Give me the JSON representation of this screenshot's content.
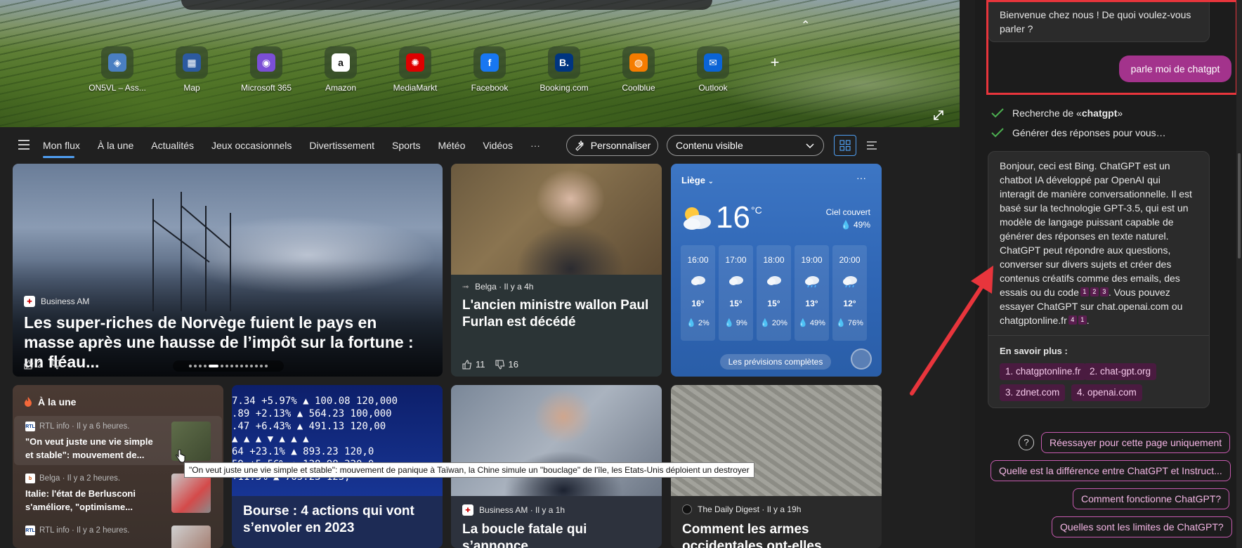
{
  "quicklinks": [
    {
      "label": "ON5VL – Ass...",
      "icon": "globe-icon",
      "color": "#4a7fc1",
      "glyph": "◈"
    },
    {
      "label": "Map",
      "icon": "map-icon",
      "color": "#2c5aa0",
      "glyph": "▦"
    },
    {
      "label": "Microsoft 365",
      "icon": "m365-icon",
      "color": "#7b4fd6",
      "glyph": "◉"
    },
    {
      "label": "Amazon",
      "icon": "amazon-icon",
      "color": "#ffffff",
      "glyph": "a"
    },
    {
      "label": "MediaMarkt",
      "icon": "mediamarkt-icon",
      "color": "#df0000",
      "glyph": "✺"
    },
    {
      "label": "Facebook",
      "icon": "facebook-icon",
      "color": "#1877f2",
      "glyph": "f"
    },
    {
      "label": "Booking.com",
      "icon": "booking-icon",
      "color": "#003580",
      "glyph": "B."
    },
    {
      "label": "Coolblue",
      "icon": "coolblue-icon",
      "color": "#f57c00",
      "glyph": "◍"
    },
    {
      "label": "Outlook",
      "icon": "outlook-icon",
      "color": "#0a64d6",
      "glyph": "✉"
    }
  ],
  "nav": {
    "tabs": [
      "Mon flux",
      "À la une",
      "Actualités",
      "Jeux occasionnels",
      "Divertissement",
      "Sports",
      "Météo",
      "Vidéos"
    ],
    "more": "···",
    "personalize": "Personnaliser",
    "content_select": "Contenu visible"
  },
  "card_norway": {
    "source": "Business AM",
    "headline": "Les super-riches de Norvège fuient le pays en masse après une hausse de l’impôt sur la fortune : un fléau...",
    "likes": "2"
  },
  "card_furlan": {
    "source": "Belga · Il y a 4h",
    "headline": "L'ancien ministre wallon Paul Furlan est décédé",
    "likes": "11",
    "dislikes": "16"
  },
  "weather": {
    "city": "Liège",
    "temp": "16",
    "unit": "°C",
    "condition": "Ciel couvert",
    "precip": "49%",
    "hours": [
      {
        "time": "16:00",
        "temp": "16°",
        "prec": "2%"
      },
      {
        "time": "17:00",
        "temp": "15°",
        "prec": "9%"
      },
      {
        "time": "18:00",
        "temp": "15°",
        "prec": "20%"
      },
      {
        "time": "19:00",
        "temp": "13°",
        "prec": "49%"
      },
      {
        "time": "20:00",
        "temp": "12°",
        "prec": "76%"
      }
    ],
    "forecast_btn": "Les prévisions complètes"
  },
  "trending": {
    "title": "À la une",
    "items": [
      {
        "source": "RTL info · Il y a 6 heures.",
        "text": "\"On veut juste une vie simple et stable\": mouvement de..."
      },
      {
        "source": "Belga · Il y a 2 heures.",
        "text": "Italie: l'état de Berlusconi s'améliore, \"optimisme..."
      },
      {
        "source": "RTL info · Il y a 2 heures.",
        "text": ""
      }
    ]
  },
  "card_bourse": {
    "headline": "Bourse : 4 actions qui vont s’envoler en 2023",
    "ticker": [
      "7.34  +5.97% ▲ 100.08  120,000",
      ".89  +2.13% ▲ 564.23  100,000",
      ".47  +6.43% ▲ 491.13  120,00",
      "  ▲  ▲  ▲  ▼  ▲  ▲  ▲",
      "64  +23.1% ▲ 893.23  120,0",
      "59  +5.56% ▲ 128.98  320,0",
      "   +11.3% ▲ 765.23  125,"
    ]
  },
  "card_roubini": {
    "source": "Business AM · Il y a 1h",
    "headline": "La boucle fatale qui s’annonce"
  },
  "card_tank": {
    "source": "The Daily Digest · Il y a 19h",
    "headline": "Comment les armes occidentales ont-elles"
  },
  "tooltip": "\"On veut juste une vie simple et stable\": mouvement de panique à Taïwan, la Chine simule un \"bouclage\" de l'île, les Etats-Unis déploient un destroyer",
  "chat": {
    "welcome": "Bienvenue chez nous ! De quoi voulez-vous parler ?",
    "user_message": "parle moi de chatgpt",
    "step1_prefix": "Recherche de «",
    "step1_term": "chatgpt",
    "step1_suffix": "»",
    "step2": "Générer des réponses pour vous…",
    "answer_p1": "Bonjour, ceci est Bing. ChatGPT est un chatbot IA développé par OpenAI qui interagit de manière conversationnelle. Il est basé sur la technologie GPT-3.5, qui est un modèle de langage puissant capable de générer des réponses en texte naturel. ChatGPT peut répondre aux questions, converser sur divers sujets et créer des contenus créatifs comme des emails, des essais ou du code",
    "answer_p2": ". Vous pouvez essayer ChatGPT sur chat.openai.com ou chatgptonline.fr",
    "answer_end": ".",
    "cites_a": [
      "1",
      "2",
      "3"
    ],
    "cites_b": [
      "4",
      "1"
    ],
    "learn_more": "En savoir plus :",
    "links": [
      "1. chatgptonline.fr",
      "2. chat-gpt.org",
      "3. zdnet.com",
      "4. openai.com"
    ],
    "suggestions": [
      "Réessayer pour cette page uniquement",
      "Quelle est la différence entre ChatGPT et Instruct...",
      "Comment fonctionne ChatGPT?",
      "Quelles sont les limites de ChatGPT?"
    ],
    "help": "?"
  },
  "colors": {
    "accent": "#4f9ef0",
    "annotation_red": "#e8353c",
    "user_bubble": "#a3338c"
  }
}
